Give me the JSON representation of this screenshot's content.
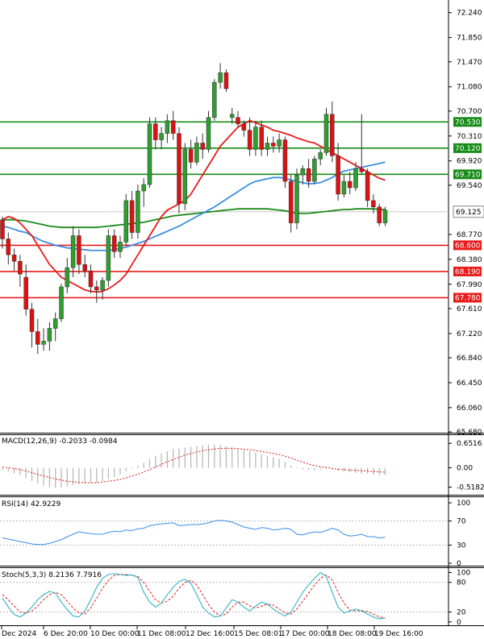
{
  "chart_data": [
    {
      "type": "candlestick",
      "panel": "price",
      "y_ticks": [
        "72.240",
        "71.850",
        "71.470",
        "71.080",
        "70.700",
        "70.310",
        "69.920",
        "69.540",
        "68.770",
        "68.380",
        "67.990",
        "67.610",
        "67.220",
        "66.840",
        "66.450",
        "66.060",
        "65.680"
      ],
      "y_tick_values": [
        72.24,
        71.85,
        71.47,
        71.08,
        70.7,
        70.31,
        69.92,
        69.54,
        68.77,
        68.38,
        67.99,
        67.61,
        67.22,
        66.84,
        66.45,
        66.06,
        65.68
      ],
      "ylim": [
        65.68,
        72.4
      ],
      "x_labels": [
        "Dec 2024",
        "6 Dec 20:00",
        "10 Dec 00:00",
        "11 Dec 08:00",
        "12 Dec 16:00",
        "15 Dec 08:01",
        "17 Dec 00:00",
        "18 Dec 08:00",
        "19 Dec 16:00"
      ],
      "current_price": "69.125",
      "current_price_value": 69.125,
      "candles": [
        [
          69.0,
          69.05,
          68.55,
          68.7
        ],
        [
          68.7,
          68.8,
          68.3,
          68.45
        ],
        [
          68.45,
          68.55,
          68.2,
          68.35
        ],
        [
          68.35,
          68.45,
          67.95,
          68.15
        ],
        [
          68.1,
          68.3,
          67.5,
          67.6
        ],
        [
          67.6,
          67.7,
          67.0,
          67.25
        ],
        [
          67.25,
          67.45,
          66.9,
          67.05
        ],
        [
          67.05,
          67.3,
          66.95,
          67.1
        ],
        [
          67.1,
          67.4,
          66.95,
          67.3
        ],
        [
          67.3,
          67.55,
          67.1,
          67.45
        ],
        [
          67.45,
          68.0,
          67.4,
          67.95
        ],
        [
          67.95,
          68.4,
          67.85,
          68.25
        ],
        [
          68.25,
          68.9,
          68.1,
          68.75
        ],
        [
          68.75,
          68.85,
          68.15,
          68.3
        ],
        [
          68.3,
          68.45,
          68.1,
          68.2
        ],
        [
          68.2,
          68.3,
          67.85,
          67.95
        ],
        [
          67.95,
          68.05,
          67.7,
          67.9
        ],
        [
          67.9,
          68.1,
          67.75,
          68.05
        ],
        [
          68.05,
          68.85,
          67.95,
          68.75
        ],
        [
          68.75,
          68.85,
          68.4,
          68.5
        ],
        [
          68.5,
          68.75,
          68.4,
          68.65
        ],
        [
          68.65,
          69.4,
          68.6,
          69.3
        ],
        [
          69.3,
          69.45,
          68.7,
          68.8
        ],
        [
          68.8,
          69.55,
          68.7,
          69.45
        ],
        [
          69.45,
          69.65,
          69.2,
          69.55
        ],
        [
          69.55,
          70.6,
          69.5,
          70.5
        ],
        [
          70.5,
          70.6,
          70.1,
          70.25
        ],
        [
          70.25,
          70.45,
          70.1,
          70.35
        ],
        [
          70.35,
          70.65,
          70.2,
          70.55
        ],
        [
          70.55,
          70.7,
          70.25,
          70.35
        ],
        [
          70.35,
          70.45,
          69.1,
          69.25
        ],
        [
          69.25,
          70.2,
          69.15,
          70.1
        ],
        [
          70.1,
          70.25,
          69.8,
          69.9
        ],
        [
          69.9,
          70.3,
          69.85,
          70.2
        ],
        [
          70.2,
          70.35,
          69.95,
          70.1
        ],
        [
          70.1,
          70.7,
          70.05,
          70.6
        ],
        [
          70.6,
          71.2,
          70.55,
          71.15
        ],
        [
          71.15,
          71.45,
          71.05,
          71.3
        ],
        [
          71.3,
          71.35,
          71.0,
          71.05
        ],
        [
          70.6,
          70.75,
          70.5,
          70.65
        ],
        [
          70.6,
          70.7,
          70.45,
          70.5
        ],
        [
          70.5,
          70.55,
          70.3,
          70.4
        ],
        [
          70.4,
          70.6,
          70.0,
          70.1
        ],
        [
          70.1,
          70.55,
          70.0,
          70.45
        ],
        [
          70.45,
          70.55,
          70.0,
          70.1
        ],
        [
          70.1,
          70.3,
          70.0,
          70.2
        ],
        [
          70.2,
          70.3,
          70.05,
          70.15
        ],
        [
          70.15,
          70.35,
          70.05,
          70.25
        ],
        [
          70.25,
          70.3,
          69.5,
          69.6
        ],
        [
          69.6,
          69.7,
          68.8,
          68.95
        ],
        [
          68.95,
          69.8,
          68.85,
          69.7
        ],
        [
          69.7,
          69.85,
          69.55,
          69.8
        ],
        [
          69.8,
          69.95,
          69.5,
          69.6
        ],
        [
          69.6,
          70.0,
          69.55,
          69.95
        ],
        [
          69.95,
          70.1,
          69.85,
          70.05
        ],
        [
          70.05,
          70.75,
          70.0,
          70.65
        ],
        [
          70.65,
          70.85,
          69.9,
          70.0
        ],
        [
          70.0,
          70.2,
          69.3,
          69.4
        ],
        [
          69.4,
          69.7,
          69.35,
          69.6
        ],
        [
          69.6,
          69.75,
          69.4,
          69.5
        ],
        [
          69.5,
          69.9,
          69.45,
          69.8
        ],
        [
          69.8,
          70.65,
          69.7,
          69.75
        ],
        [
          69.75,
          69.8,
          69.2,
          69.3
        ],
        [
          69.3,
          69.4,
          69.1,
          69.2
        ],
        [
          69.2,
          69.25,
          68.9,
          68.95
        ],
        [
          68.95,
          69.2,
          68.9,
          69.15
        ]
      ],
      "ma_red": [
        69.0,
        69.05,
        69.02,
        68.95,
        68.85,
        68.75,
        68.6,
        68.45,
        68.3,
        68.2,
        68.1,
        68.05,
        68.0,
        67.95,
        67.9,
        67.88,
        67.87,
        67.88,
        67.92,
        67.98,
        68.05,
        68.15,
        68.3,
        68.45,
        68.6,
        68.75,
        68.9,
        69.05,
        69.15,
        69.2,
        69.25,
        69.3,
        69.4,
        69.55,
        69.7,
        69.85,
        70.0,
        70.15,
        70.25,
        70.35,
        70.45,
        70.5,
        70.55,
        70.52,
        70.48,
        70.45,
        70.4,
        70.38,
        70.35,
        70.32,
        70.28,
        70.25,
        70.22,
        70.2,
        70.15,
        70.1,
        70.05,
        70.0,
        69.95,
        69.9,
        69.85,
        69.8,
        69.75,
        69.7,
        69.65,
        69.62
      ],
      "ma_blue": [
        68.9,
        68.88,
        68.85,
        68.82,
        68.8,
        68.75,
        68.7,
        68.66,
        68.63,
        68.6,
        68.58,
        68.56,
        68.55,
        68.54,
        68.53,
        68.52,
        68.52,
        68.52,
        68.52,
        68.53,
        68.55,
        68.57,
        68.6,
        68.63,
        68.66,
        68.7,
        68.74,
        68.78,
        68.82,
        68.86,
        68.9,
        68.95,
        69.0,
        69.05,
        69.1,
        69.15,
        69.2,
        69.26,
        69.32,
        69.38,
        69.44,
        69.5,
        69.56,
        69.6,
        69.62,
        69.64,
        69.66,
        69.66,
        69.65,
        69.62,
        69.6,
        69.58,
        69.56,
        69.57,
        69.58,
        69.62,
        69.66,
        69.72,
        69.76,
        69.78,
        69.8,
        69.82,
        69.84,
        69.86,
        69.88,
        69.9
      ],
      "ma_green": [
        69.0,
        69.0,
        69.0,
        68.99,
        68.98,
        68.96,
        68.94,
        68.92,
        68.9,
        68.89,
        68.88,
        68.88,
        68.88,
        68.88,
        68.88,
        68.88,
        68.88,
        68.89,
        68.9,
        68.91,
        68.92,
        68.93,
        68.94,
        68.95,
        68.96,
        68.98,
        69.0,
        69.02,
        69.04,
        69.06,
        69.07,
        69.08,
        69.09,
        69.1,
        69.11,
        69.12,
        69.13,
        69.14,
        69.15,
        69.16,
        69.17,
        69.17,
        69.17,
        69.17,
        69.17,
        69.17,
        69.16,
        69.15,
        69.14,
        69.12,
        69.1,
        69.1,
        69.1,
        69.11,
        69.12,
        69.13,
        69.14,
        69.15,
        69.16,
        69.16,
        69.17,
        69.17,
        69.17,
        69.17,
        69.16,
        69.16
      ],
      "levels_green": [
        {
          "label": "70.530",
          "value": 70.53
        },
        {
          "label": "70.120",
          "value": 70.12
        },
        {
          "label": "69.710",
          "value": 69.71
        }
      ],
      "levels_red": [
        {
          "label": "68.600",
          "value": 68.6
        },
        {
          "label": "68.190",
          "value": 68.19
        },
        {
          "label": "67.780",
          "value": 67.78
        }
      ],
      "colors": {
        "bull": "#2e9e2e",
        "bear": "#dd1111",
        "ma_red": "#e81c1c",
        "ma_blue": "#3a8ee6",
        "ma_green": "#1a8a1a",
        "level_green": "#178c17",
        "level_red": "#e81c1c",
        "current": "#c8c8c8"
      }
    },
    {
      "type": "bar",
      "panel": "macd",
      "title": "MACD(12,26,9) -0.2033 -0.0984",
      "y_ticks": [
        "0.6516",
        "0.00",
        "-0.5182"
      ],
      "y_tick_values": [
        0.6516,
        0.0,
        -0.5182
      ],
      "ylim": [
        -0.7,
        0.85
      ],
      "histogram": [
        -0.05,
        -0.1,
        -0.15,
        -0.2,
        -0.28,
        -0.35,
        -0.42,
        -0.48,
        -0.52,
        -0.54,
        -0.53,
        -0.5,
        -0.46,
        -0.44,
        -0.42,
        -0.41,
        -0.4,
        -0.36,
        -0.3,
        -0.24,
        -0.18,
        -0.1,
        -0.02,
        0.06,
        0.14,
        0.24,
        0.32,
        0.38,
        0.44,
        0.5,
        0.52,
        0.54,
        0.56,
        0.58,
        0.6,
        0.62,
        0.62,
        0.6,
        0.58,
        0.55,
        0.52,
        0.48,
        0.44,
        0.4,
        0.36,
        0.32,
        0.28,
        0.24,
        0.16,
        0.06,
        -0.02,
        -0.04,
        -0.06,
        -0.06,
        -0.04,
        -0.02,
        -0.04,
        -0.08,
        -0.1,
        -0.12,
        -0.14,
        -0.15,
        -0.16,
        -0.18,
        -0.2,
        -0.2
      ],
      "signal": [
        0.02,
        0.0,
        -0.02,
        -0.05,
        -0.09,
        -0.13,
        -0.18,
        -0.22,
        -0.26,
        -0.3,
        -0.33,
        -0.36,
        -0.38,
        -0.39,
        -0.4,
        -0.4,
        -0.4,
        -0.38,
        -0.36,
        -0.34,
        -0.31,
        -0.27,
        -0.22,
        -0.17,
        -0.11,
        -0.05,
        0.02,
        0.09,
        0.16,
        0.22,
        0.28,
        0.34,
        0.38,
        0.42,
        0.46,
        0.48,
        0.5,
        0.52,
        0.52,
        0.52,
        0.51,
        0.5,
        0.48,
        0.46,
        0.44,
        0.41,
        0.38,
        0.35,
        0.31,
        0.26,
        0.2,
        0.15,
        0.1,
        0.06,
        0.03,
        0.01,
        -0.02,
        -0.04,
        -0.05,
        -0.06,
        -0.07,
        -0.08,
        -0.09,
        -0.1,
        -0.11,
        -0.12
      ],
      "colors": {
        "hist": "#b4b4b4",
        "signal": "#e81c1c"
      }
    },
    {
      "type": "line",
      "panel": "rsi",
      "title": "RSI(14) 42.9229",
      "y_ticks": [
        "100",
        "70",
        "30",
        "0"
      ],
      "y_tick_values": [
        100,
        70,
        30,
        0
      ],
      "ylim": [
        0,
        100
      ],
      "values": [
        42,
        40,
        38,
        36,
        34,
        32,
        31,
        31,
        33,
        36,
        39,
        44,
        48,
        52,
        50,
        49,
        48,
        48,
        51,
        53,
        52,
        55,
        54,
        57,
        58,
        62,
        64,
        65,
        66,
        67,
        62,
        63,
        64,
        64,
        65,
        67,
        70,
        71,
        70,
        68,
        64,
        60,
        58,
        56,
        59,
        58,
        55,
        56,
        58,
        56,
        48,
        47,
        50,
        52,
        51,
        54,
        58,
        55,
        48,
        45,
        46,
        48,
        44,
        44,
        42,
        43
      ],
      "colors": {
        "line": "#3a8ee6",
        "levels": "#bbbbbb"
      }
    },
    {
      "type": "line",
      "panel": "stoch",
      "title": "Stoch(5,3,3) 8.2136 7.7916",
      "y_ticks": [
        "100",
        "80",
        "20",
        "0"
      ],
      "y_tick_values": [
        100,
        80,
        20,
        0
      ],
      "ylim": [
        -2,
        104
      ],
      "k": [
        48,
        30,
        15,
        10,
        18,
        30,
        45,
        55,
        62,
        58,
        40,
        25,
        12,
        10,
        22,
        45,
        70,
        88,
        96,
        98,
        96,
        94,
        95,
        90,
        60,
        40,
        30,
        38,
        55,
        70,
        82,
        86,
        78,
        55,
        30,
        18,
        10,
        12,
        28,
        45,
        40,
        30,
        22,
        32,
        40,
        36,
        26,
        18,
        12,
        20,
        40,
        60,
        75,
        88,
        100,
        92,
        60,
        30,
        18,
        22,
        26,
        22,
        16,
        10,
        6,
        8
      ],
      "d": [
        55,
        45,
        32,
        20,
        18,
        22,
        32,
        45,
        55,
        60,
        55,
        42,
        28,
        18,
        16,
        28,
        48,
        68,
        84,
        94,
        96,
        96,
        95,
        92,
        80,
        62,
        45,
        38,
        42,
        52,
        68,
        80,
        84,
        75,
        55,
        35,
        20,
        12,
        16,
        30,
        40,
        40,
        32,
        28,
        32,
        36,
        34,
        26,
        18,
        16,
        26,
        42,
        58,
        75,
        88,
        95,
        85,
        60,
        38,
        24,
        22,
        23,
        21,
        16,
        10,
        8
      ],
      "colors": {
        "k": "#3fb9c9",
        "d": "#e81c1c",
        "levels": "#bbbbbb"
      }
    }
  ]
}
